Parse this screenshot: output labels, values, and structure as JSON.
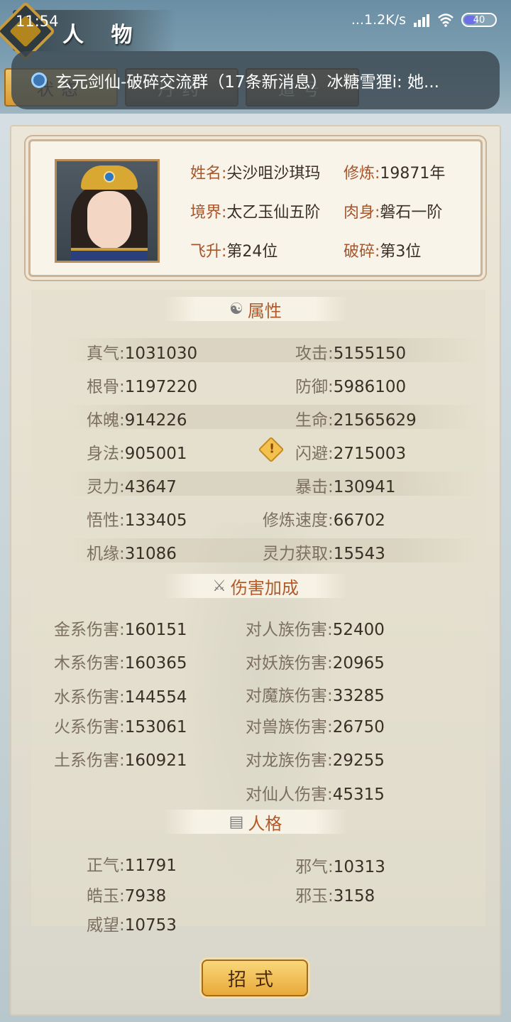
{
  "status_bar": {
    "time": "11:54",
    "net_speed": "...1.2K/s",
    "battery": "40",
    "battery_level": 0.4
  },
  "header": {
    "title": "人 物",
    "tabs": [
      {
        "label": "状态",
        "active": true
      },
      {
        "label": "丹药",
        "active": false
      },
      {
        "label": "道号",
        "active": false
      }
    ]
  },
  "notification": {
    "text": "玄元剑仙-破碎交流群（17条新消息）冰糖雪狸i: 她..."
  },
  "profile": {
    "name_label": "姓名:",
    "name": "尖沙咀沙琪玛",
    "cultivation_label": "修炼:",
    "cultivation": "19871年",
    "realm_label": "境界:",
    "realm": "太乙玉仙五阶",
    "body_label": "肉身:",
    "body": "磐石一阶",
    "ascend_label": "飞升:",
    "ascend": "第24位",
    "shatter_label": "破碎:",
    "shatter": "第3位"
  },
  "attributes": {
    "title": "属性",
    "left": [
      {
        "label": "真气:",
        "value": "1031030"
      },
      {
        "label": "根骨:",
        "value": "1197220"
      },
      {
        "label": "体魄:",
        "value": "914226"
      },
      {
        "label": "身法:",
        "value": "905001"
      },
      {
        "label": "灵力:",
        "value": "43647"
      },
      {
        "label": "悟性:",
        "value": "133405"
      },
      {
        "label": "机缘:",
        "value": "31086"
      }
    ],
    "right": [
      {
        "label": "攻击:",
        "value": "5155150"
      },
      {
        "label": "防御:",
        "value": "5986100"
      },
      {
        "label": "生命:",
        "value": "21565629"
      },
      {
        "label": "闪避:",
        "value": "2715003"
      },
      {
        "label": "暴击:",
        "value": "130941"
      },
      {
        "label": "修炼速度:",
        "value": "66702"
      },
      {
        "label": "灵力获取:",
        "value": "15543"
      }
    ]
  },
  "damage": {
    "title": "伤害加成",
    "left": [
      {
        "label": "金系伤害:",
        "value": "160151"
      },
      {
        "label": "木系伤害:",
        "value": "160365"
      },
      {
        "label": "水系伤害:",
        "value": "144554"
      },
      {
        "label": "火系伤害:",
        "value": "153061"
      },
      {
        "label": "土系伤害:",
        "value": "160921"
      }
    ],
    "right": [
      {
        "label": "对人族伤害:",
        "value": "52400"
      },
      {
        "label": "对妖族伤害:",
        "value": "20965"
      },
      {
        "label": "对魔族伤害:",
        "value": "33285"
      },
      {
        "label": "对兽族伤害:",
        "value": "26750"
      },
      {
        "label": "对龙族伤害:",
        "value": "29255"
      },
      {
        "label": "对仙人伤害:",
        "value": "45315"
      }
    ]
  },
  "personality": {
    "title": "人格",
    "left": [
      {
        "label": "正气:",
        "value": "11791"
      },
      {
        "label": "皓玉:",
        "value": "7938"
      },
      {
        "label": "威望:",
        "value": "10753"
      }
    ],
    "right": [
      {
        "label": "邪气:",
        "value": "10313"
      },
      {
        "label": "邪玉:",
        "value": "3158"
      }
    ]
  },
  "footer": {
    "skill_button": "招式"
  }
}
